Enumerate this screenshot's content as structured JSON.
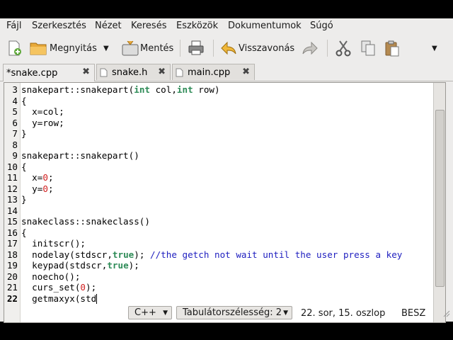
{
  "menu": [
    "Fájl",
    "Szerkesztés",
    "Nézet",
    "Keresés",
    "Eszközök",
    "Dokumentumok",
    "Súgó"
  ],
  "toolbar": {
    "open_label": "Megnyitás",
    "save_label": "Mentés",
    "undo_label": "Visszavonás"
  },
  "tabs": [
    {
      "label": "*snake.cpp",
      "close": "✖"
    },
    {
      "label": "snake.h",
      "close": "✖"
    },
    {
      "label": "main.cpp",
      "close": "✖"
    }
  ],
  "code_lines": [
    {
      "n": "3",
      "text": "snakepart::snakepart(int col,int row)"
    },
    {
      "n": "4",
      "text": "{"
    },
    {
      "n": "5",
      "text": "  x=col;"
    },
    {
      "n": "6",
      "text": "  y=row;"
    },
    {
      "n": "7",
      "text": "}"
    },
    {
      "n": "8",
      "text": ""
    },
    {
      "n": "9",
      "text": "snakepart::snakepart()"
    },
    {
      "n": "10",
      "text": "{"
    },
    {
      "n": "11",
      "text": "  x=0;"
    },
    {
      "n": "12",
      "text": "  y=0;"
    },
    {
      "n": "13",
      "text": "}"
    },
    {
      "n": "14",
      "text": ""
    },
    {
      "n": "15",
      "text": "snakeclass::snakeclass()"
    },
    {
      "n": "16",
      "text": "{"
    },
    {
      "n": "17",
      "text": "  initscr();"
    },
    {
      "n": "18",
      "text": "  nodelay(stdscr,true); //the getch not wait until the user press a key"
    },
    {
      "n": "19",
      "text": "  keypad(stdscr,true);"
    },
    {
      "n": "20",
      "text": "  noecho();"
    },
    {
      "n": "21",
      "text": "  curs_set(0);"
    },
    {
      "n": "22",
      "text": "  getmaxyx(std"
    }
  ],
  "status": {
    "language": "C++",
    "tab_width": "Tabulátorszélesség: 2",
    "position": "22. sor, 15. oszlop",
    "mode": "BESZ"
  },
  "colors": {
    "keyword": "#2e8b57",
    "number": "#d02020",
    "comment": "#2020c0",
    "accent": "#f0a030"
  }
}
